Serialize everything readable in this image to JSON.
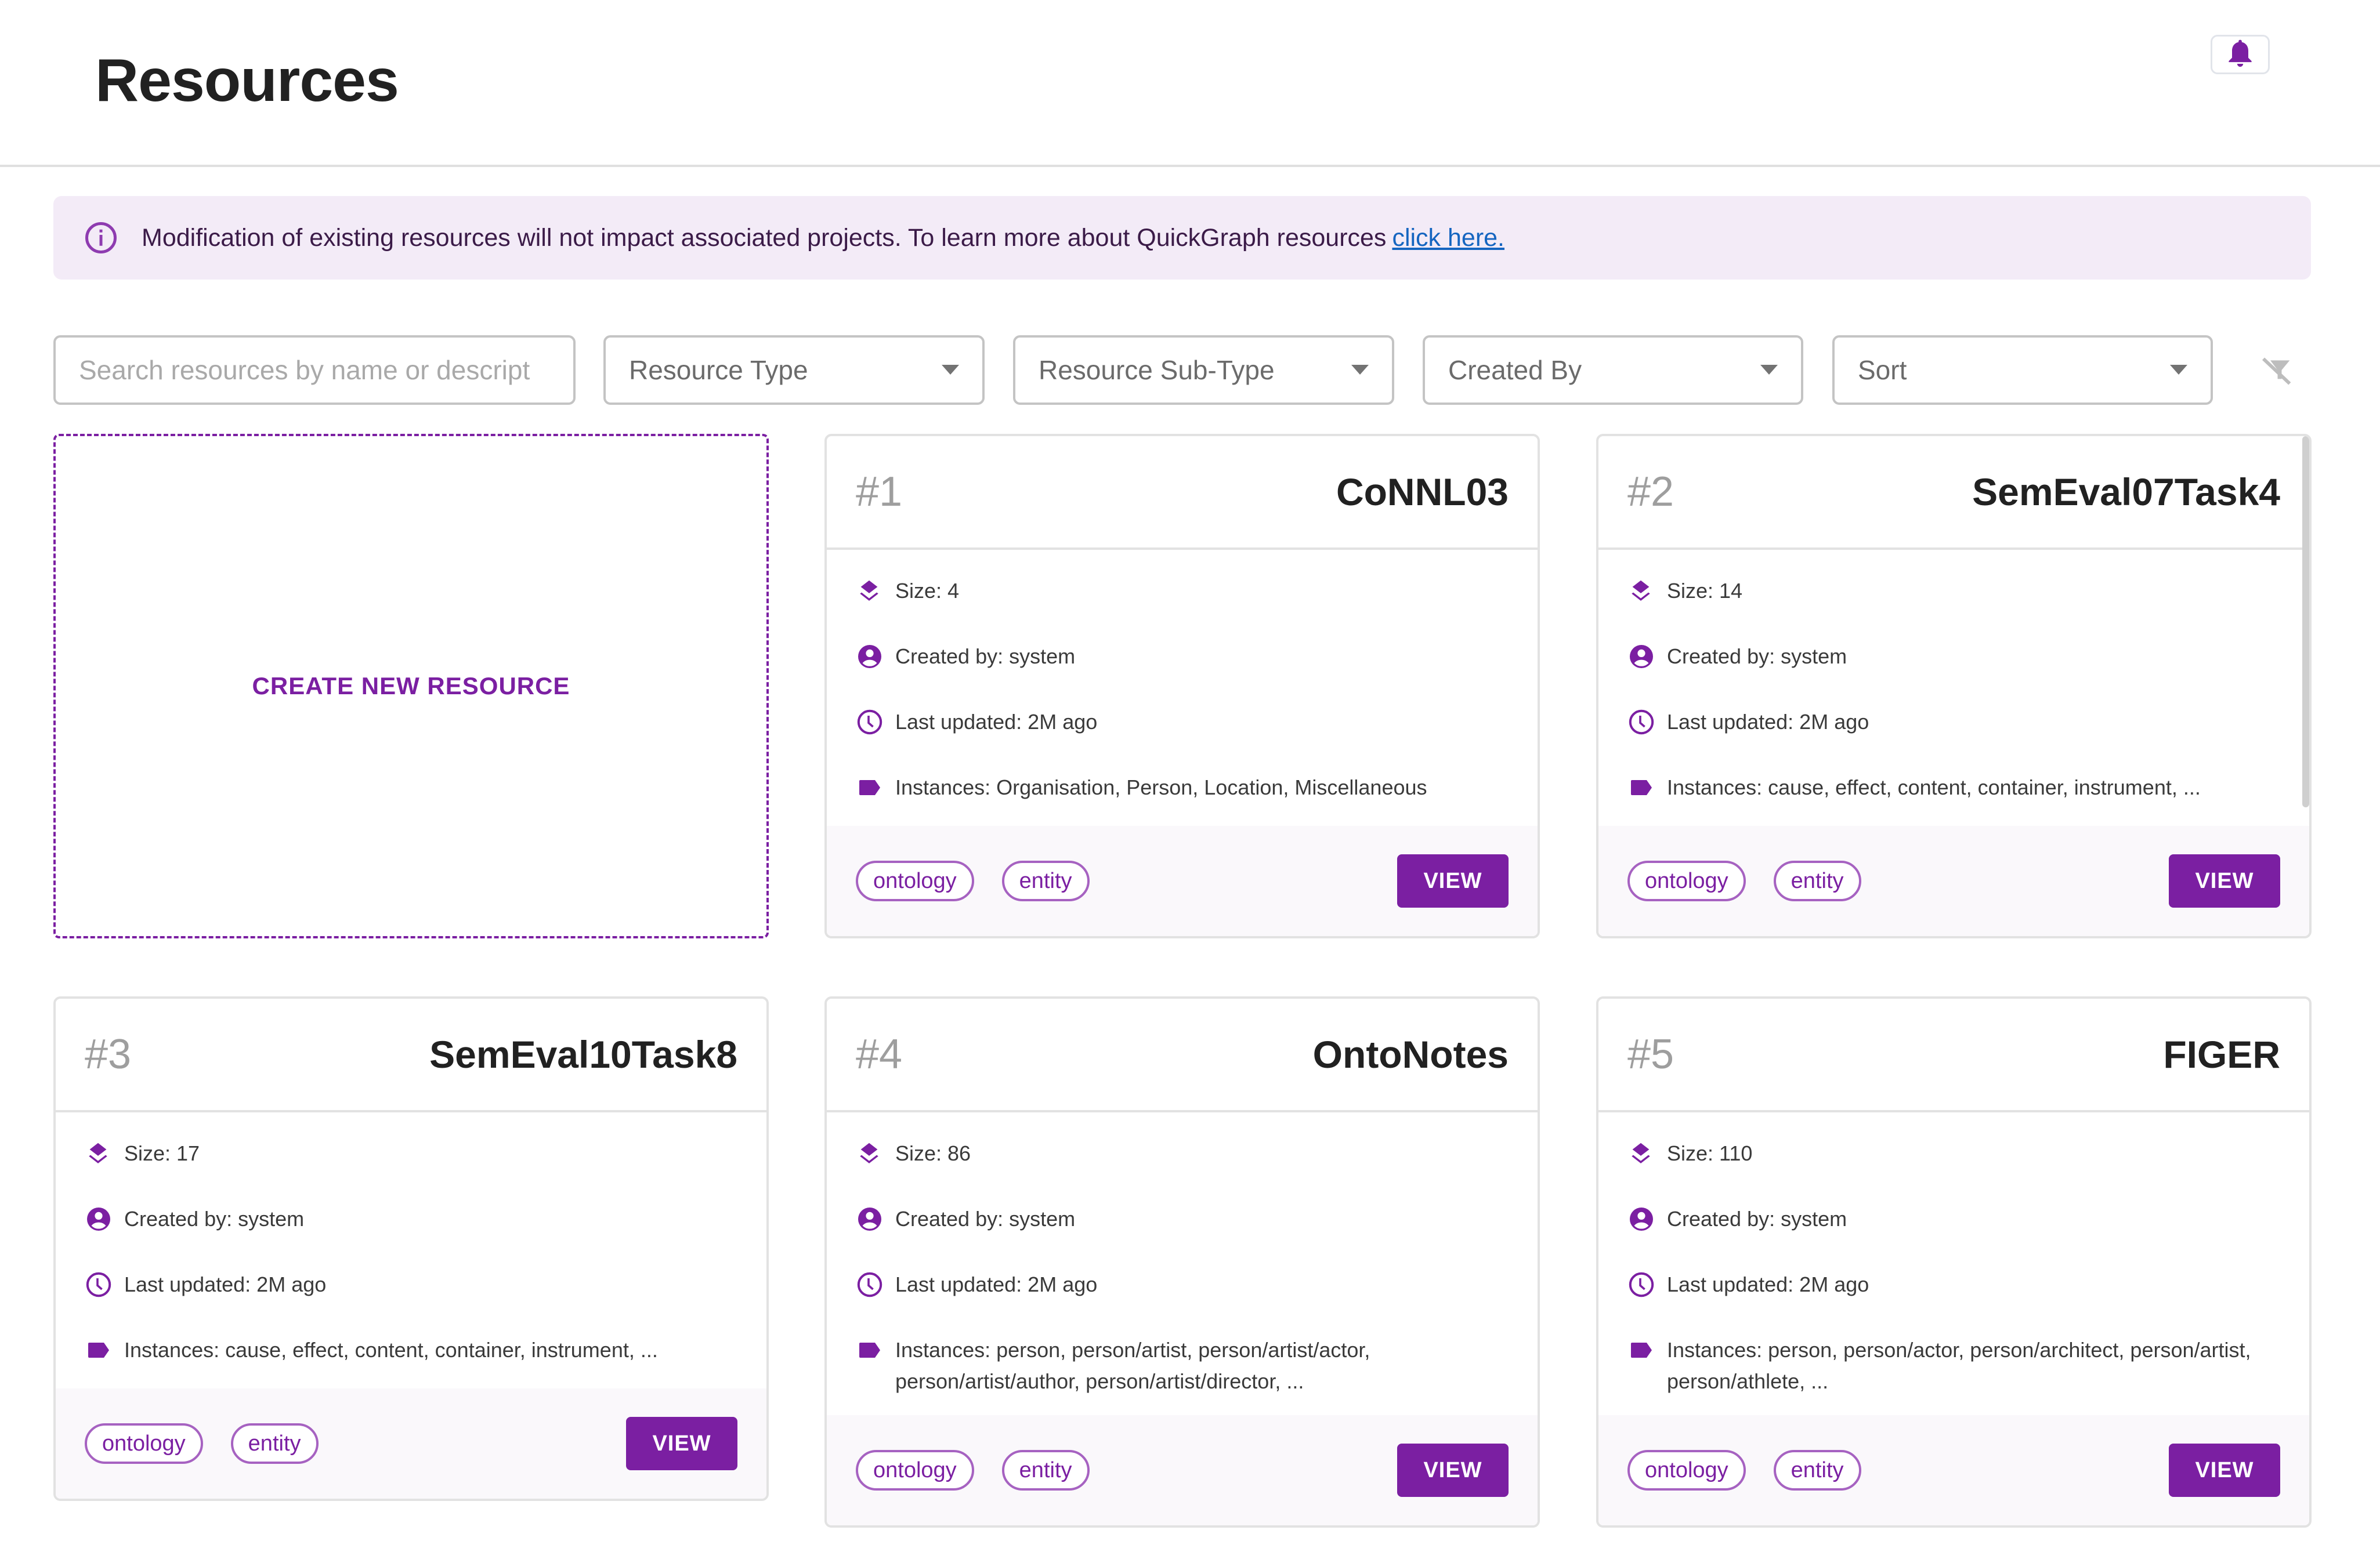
{
  "header": {
    "title": "Resources",
    "notifications_icon": "bell-icon"
  },
  "alert": {
    "icon": "info-icon",
    "message": "Modification of existing resources will not impact associated projects. To learn more about QuickGraph resources",
    "link_label": "click here."
  },
  "filters": {
    "search_placeholder": "Search resources by name or descript",
    "search_value": "",
    "resource_type": "Resource Type",
    "resource_sub_type": "Resource Sub-Type",
    "created_by": "Created By",
    "sort": "Sort",
    "clear_icon": "filter-off-icon"
  },
  "create_card": {
    "label": "CREATE NEW RESOURCE"
  },
  "theme": {
    "accent": "#7b1fa2",
    "alert_bg": "#f3ebf7",
    "link": "#1565c0"
  },
  "cards": [
    {
      "index": "#1",
      "name": "CoNNL03",
      "size": "Size: 4",
      "created_by": "Created by: system",
      "last_updated": "Last updated: 2M ago",
      "instances": "Instances: Organisation, Person, Location, Miscellaneous",
      "tags": [
        "ontology",
        "entity"
      ],
      "view_label": "VIEW"
    },
    {
      "index": "#2",
      "name": "SemEval07Task4",
      "size": "Size: 14",
      "created_by": "Created by: system",
      "last_updated": "Last updated: 2M ago",
      "instances": "Instances: cause, effect, content, container, instrument, ...",
      "tags": [
        "ontology",
        "entity"
      ],
      "view_label": "VIEW"
    },
    {
      "index": "#3",
      "name": "SemEval10Task8",
      "size": "Size: 17",
      "created_by": "Created by: system",
      "last_updated": "Last updated: 2M ago",
      "instances": "Instances: cause, effect, content, container, instrument, ...",
      "tags": [
        "ontology",
        "entity"
      ],
      "view_label": "VIEW"
    },
    {
      "index": "#4",
      "name": "OntoNotes",
      "size": "Size: 86",
      "created_by": "Created by: system",
      "last_updated": "Last updated: 2M ago",
      "instances": "Instances: person, person/artist, person/artist/actor, person/artist/author, person/artist/director, ...",
      "tags": [
        "ontology",
        "entity"
      ],
      "view_label": "VIEW"
    },
    {
      "index": "#5",
      "name": "FIGER",
      "size": "Size: 110",
      "created_by": "Created by: system",
      "last_updated": "Last updated: 2M ago",
      "instances": "Instances: person, person/actor, person/architect, person/artist, person/athlete, ...",
      "tags": [
        "ontology",
        "entity"
      ],
      "view_label": "VIEW"
    }
  ]
}
